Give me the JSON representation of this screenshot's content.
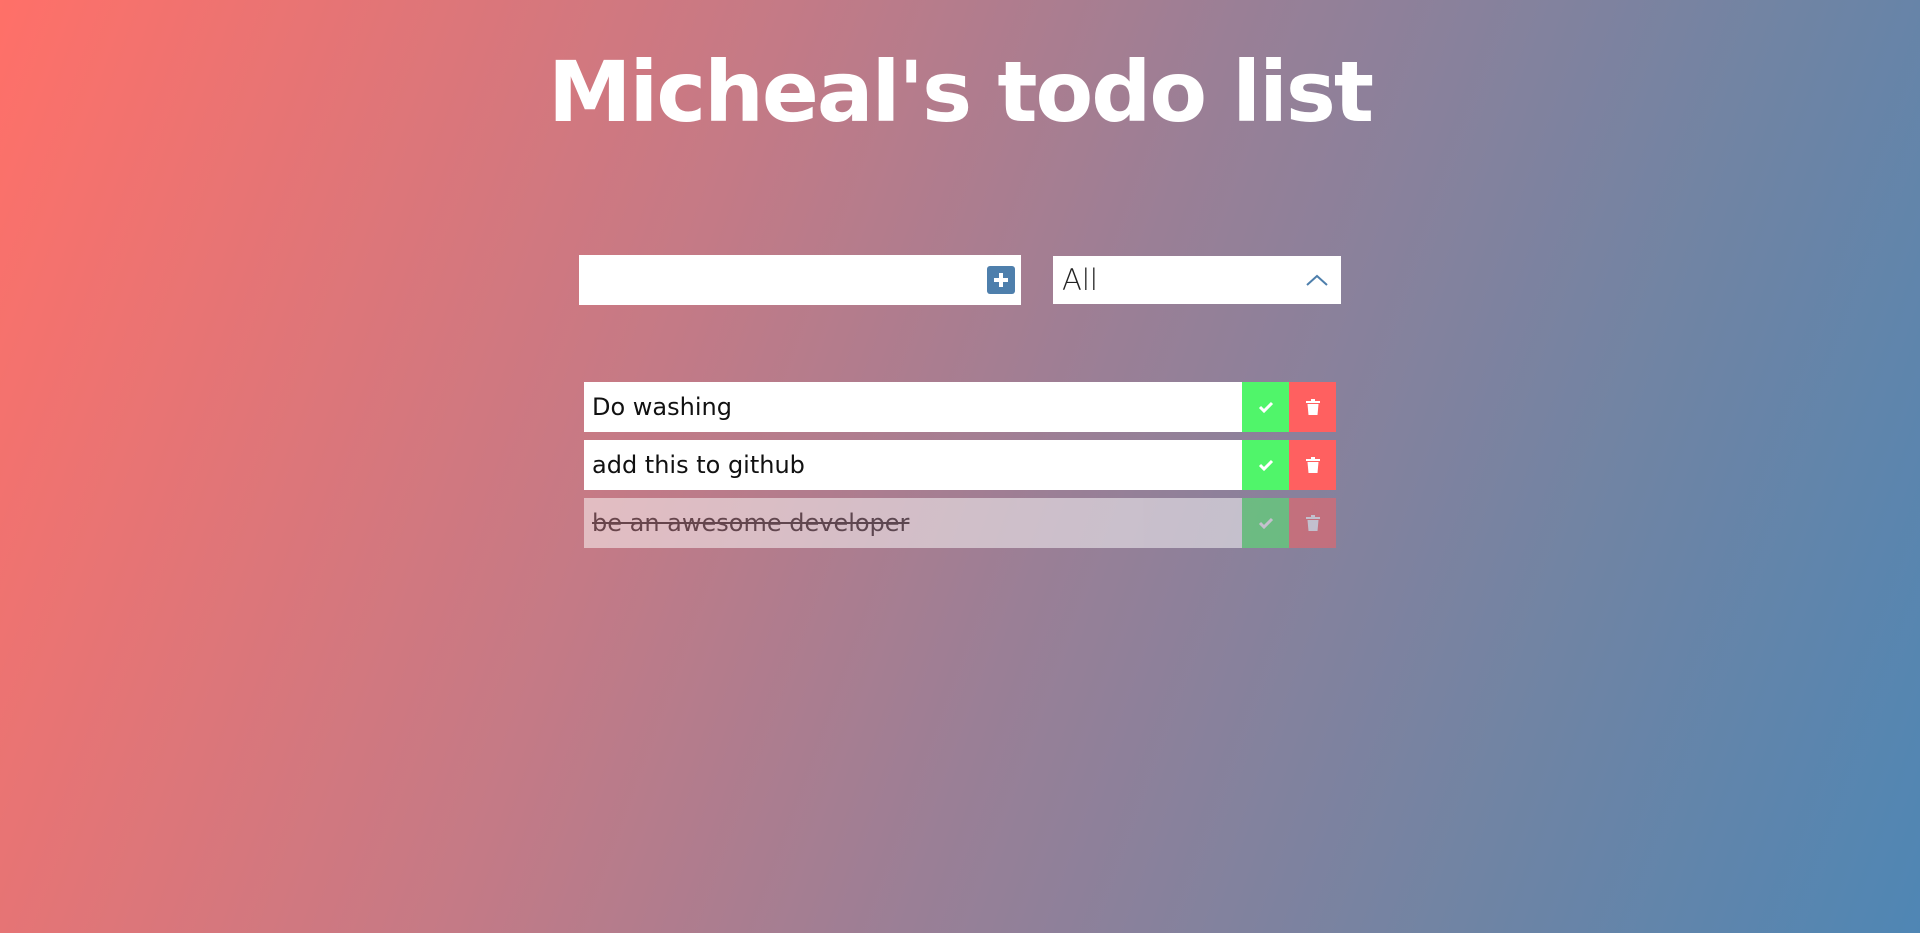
{
  "header": {
    "title": "Micheal's todo list"
  },
  "form": {
    "input_value": "",
    "input_placeholder": "",
    "add_icon": "plus-square-icon",
    "filter_selected": "All",
    "filter_icon": "chevron-up-icon"
  },
  "todos": [
    {
      "text": "Do washing",
      "completed": false
    },
    {
      "text": "add this to github",
      "completed": false
    },
    {
      "text": "be an awesome developer",
      "completed": true
    }
  ],
  "colors": {
    "accent": "#4e7fac",
    "complete": "#50f56a",
    "delete": "#ff6060",
    "gradient_start": "#ff7068",
    "gradient_end": "#4f86b4"
  }
}
